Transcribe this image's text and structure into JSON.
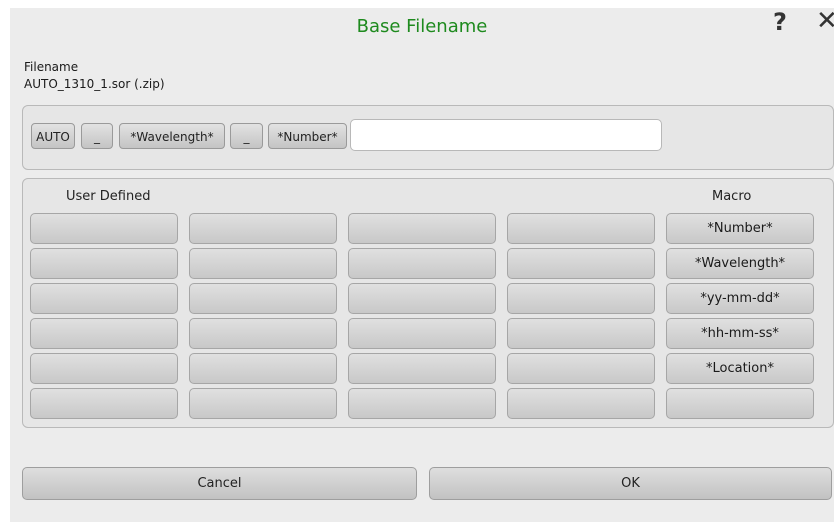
{
  "dialog": {
    "title": "Base Filename",
    "help_glyph": "?",
    "close_glyph": "✕"
  },
  "filename": {
    "label": "Filename",
    "value": "AUTO_1310_1.sor (.zip)"
  },
  "builder": {
    "chips": [
      "AUTO",
      "_",
      "*Wavelength*",
      "_",
      "*Number*"
    ],
    "input_value": ""
  },
  "grid": {
    "user_defined_header": "User Defined",
    "macro_header": "Macro",
    "user_defined_rows": 6,
    "macros": [
      "*Number*",
      "*Wavelength*",
      "*yy-mm-dd*",
      "*hh-mm-ss*",
      "*Location*",
      ""
    ]
  },
  "buttons": {
    "cancel": "Cancel",
    "ok": "OK"
  }
}
